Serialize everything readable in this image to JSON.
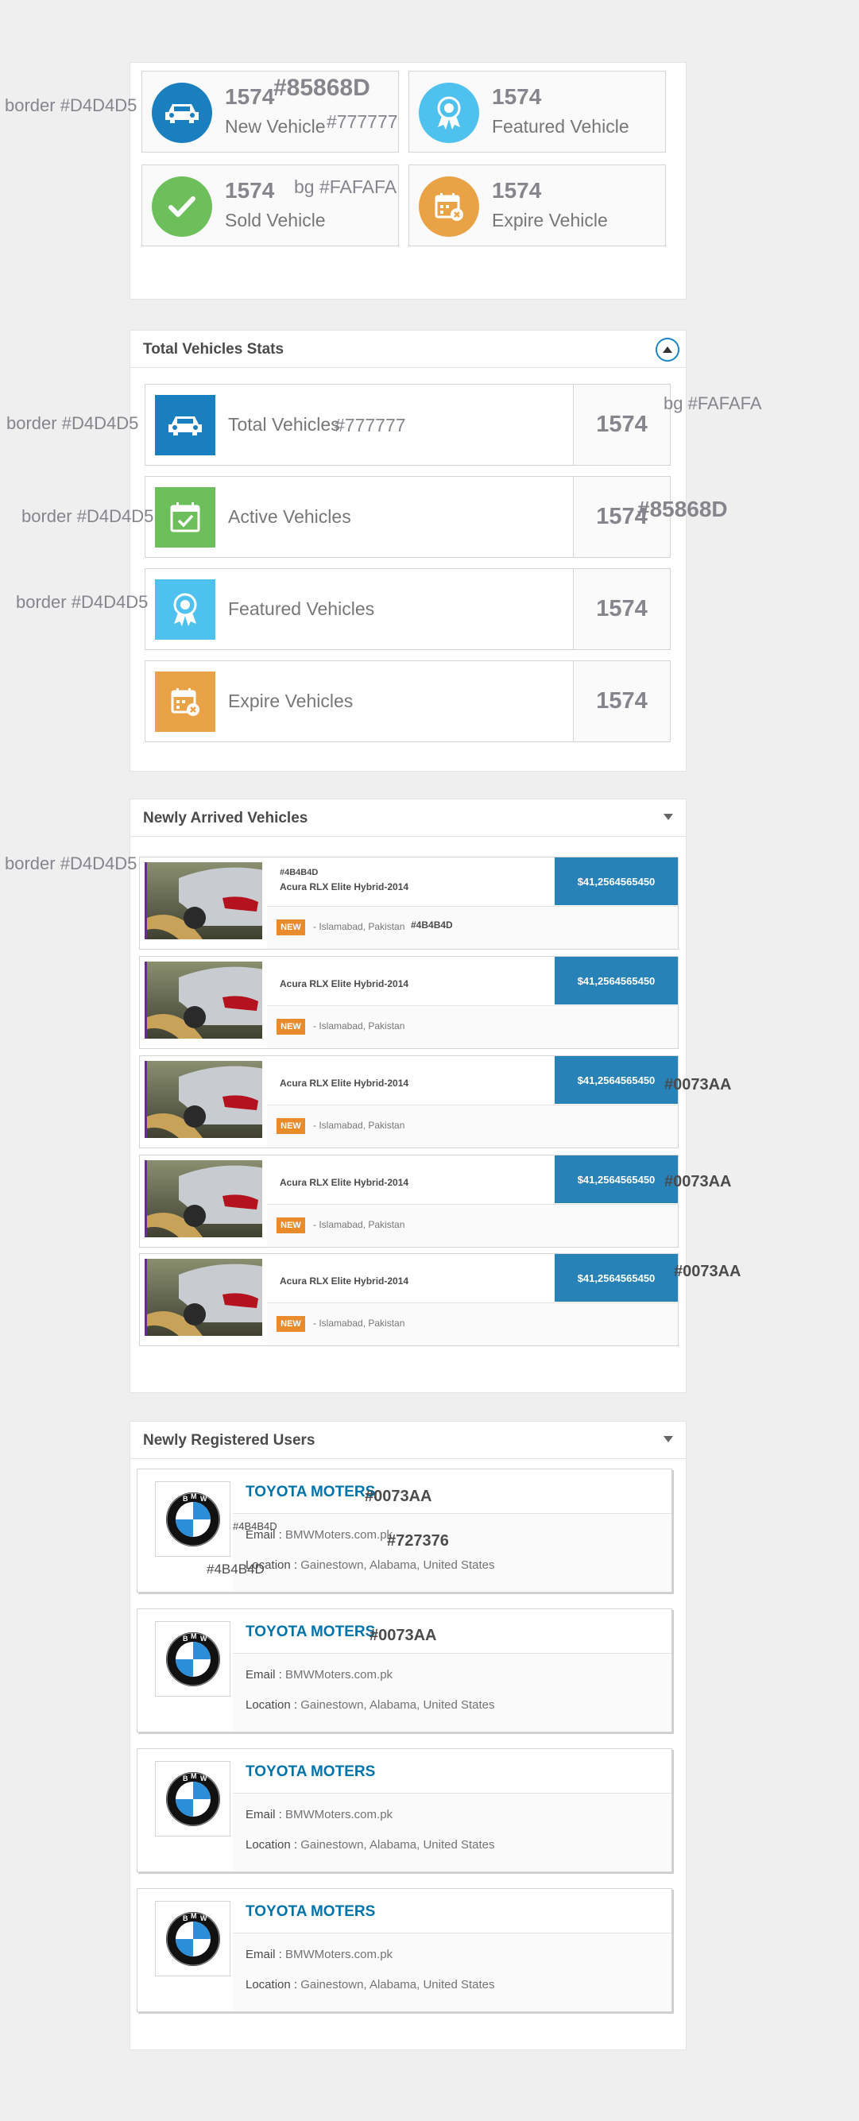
{
  "colors": {
    "accent": "#0073AA",
    "card_bg": "#FAFAFA",
    "border": "#D4D4D5",
    "number": "#85868D",
    "label": "#777777",
    "dark_text": "#4B4B4D",
    "price_bg": "#2682B7",
    "new_badge": "#E88B2C"
  },
  "stats": [
    {
      "icon": "car-icon",
      "value": "1574",
      "label": "New Vehicle",
      "color": "#1a7fbf"
    },
    {
      "icon": "award-ribbon-icon",
      "value": "1574",
      "label": "Featured Vehicle",
      "color": "#4fc1ef"
    },
    {
      "icon": "check-icon",
      "value": "1574",
      "label": "Sold Vehicle",
      "color": "#6cbf5a"
    },
    {
      "icon": "calendar-expire-icon",
      "value": "1574",
      "label": "Expire Vehicle",
      "color": "#eaa246"
    }
  ],
  "total_stats": {
    "title": "Total Vehicles Stats",
    "rows": [
      {
        "icon": "car-icon",
        "label": "Total Vehicles",
        "value": "1574",
        "color": "#1a7fbf"
      },
      {
        "icon": "calendar-check-icon",
        "label": "Active Vehicles",
        "value": "1574",
        "color": "#6cbf5a"
      },
      {
        "icon": "award-ribbon-icon",
        "label": "Featured Vehicles",
        "value": "1574",
        "color": "#4fc1ef"
      },
      {
        "icon": "calendar-expire-icon",
        "label": "Expire Vehicles",
        "value": "1574",
        "color": "#eaa246"
      }
    ]
  },
  "arrived": {
    "title": "Newly Arrived Vehicles",
    "badge": "NEW",
    "items": [
      {
        "name": "Acura RLX Elite Hybrid-2014",
        "price": "$41,2564565450",
        "location": "- Islamabad, Pakistan"
      },
      {
        "name": "Acura RLX Elite Hybrid-2014",
        "price": "$41,2564565450",
        "location": "- Islamabad, Pakistan"
      },
      {
        "name": "Acura RLX Elite Hybrid-2014",
        "price": "$41,2564565450",
        "location": "- Islamabad, Pakistan"
      },
      {
        "name": "Acura RLX Elite Hybrid-2014",
        "price": "$41,2564565450",
        "location": "- Islamabad, Pakistan"
      },
      {
        "name": "Acura RLX Elite Hybrid-2014",
        "price": "$41,2564565450",
        "location": "- Islamabad, Pakistan"
      }
    ]
  },
  "users": {
    "title": "Newly Registered Users",
    "email_label": "Email :",
    "location_label": "Location :",
    "items": [
      {
        "name": "TOYOTA MOTERS",
        "email": "BMWMoters.com.pk",
        "location": "Gainestown, Alabama, United States"
      },
      {
        "name": "TOYOTA MOTERS",
        "email": "BMWMoters.com.pk",
        "location": "Gainestown, Alabama, United States"
      },
      {
        "name": "TOYOTA MOTERS",
        "email": "BMWMoters.com.pk",
        "location": "Gainestown, Alabama, United States"
      },
      {
        "name": "TOYOTA MOTERS",
        "email": "BMWMoters.com.pk",
        "location": "Gainestown, Alabama, United States"
      }
    ]
  },
  "annotations": {
    "border": "border #D4D4D5",
    "num_color": "#85868D",
    "label_color": "#777777",
    "bg": "bg #FAFAFA",
    "dark": "#4B4B4D",
    "accent": "#0073AA",
    "email_color": "#727376"
  }
}
